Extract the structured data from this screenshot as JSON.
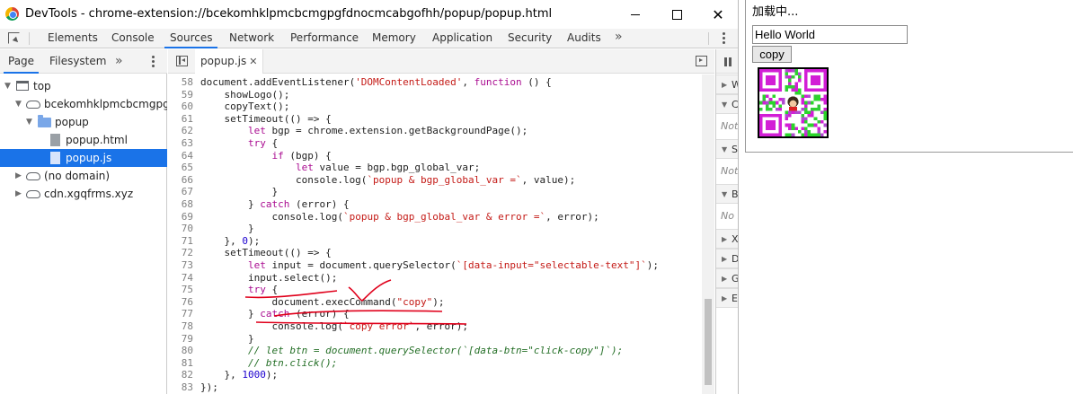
{
  "window": {
    "title": "DevTools - chrome-extension://bcekomhklpmcbcmgpgfdnocmcabgofhh/popup/popup.html",
    "minimize_icon": "minimize-icon",
    "maximize_icon": "maximize-icon",
    "close_glyph": "✕"
  },
  "toolbar": {
    "tabs": [
      "Elements",
      "Console",
      "Sources",
      "Network",
      "Performance",
      "Memory",
      "Application",
      "Security",
      "Audits"
    ],
    "active_tab": "Sources",
    "more_glyph": "»"
  },
  "navigator": {
    "tabs": [
      "Page",
      "Filesystem"
    ],
    "active_tab": "Page",
    "more_glyph": "»",
    "tree": [
      {
        "label": "top",
        "icon": "frame-icon"
      },
      {
        "label": "bcekomhklpmcbcmgpgfdnocmcabgofhh",
        "icon": "cloud-icon"
      },
      {
        "label": "popup",
        "icon": "folder-icon"
      },
      {
        "label": "popup.html",
        "icon": "file-icon"
      },
      {
        "label": "popup.js",
        "icon": "file-icon",
        "selected": true
      },
      {
        "label": "(no domain)",
        "icon": "cloud-icon"
      },
      {
        "label": "cdn.xgqfrms.xyz",
        "icon": "cloud-icon"
      }
    ]
  },
  "editor": {
    "open_file": "popup.js",
    "close_glyph": "✕",
    "first_line_number": 58,
    "lines": [
      "document.addEventListener('DOMContentLoaded', function () {",
      "    showLogo();",
      "    copyText();",
      "    setTimeout(() => {",
      "        let bgp = chrome.extension.getBackgroundPage();",
      "        try {",
      "            if (bgp) {",
      "                let value = bgp.bgp_global_var;",
      "                console.log(`popup & bgp_global_var =`, value);",
      "            }",
      "        } catch (error) {",
      "            console.log(`popup & bgp_global_var & error =`, error);",
      "        }",
      "    }, 0);",
      "    setTimeout(() => {",
      "        let input = document.querySelector(`[data-input=\"selectable-text\"]`);",
      "        input.select();",
      "        try {",
      "            document.execCommand(\"copy\");",
      "        } catch (error) {",
      "            console.log(`copy error`, error);",
      "        }",
      "        // let btn = document.querySelector(`[data-btn=\"click-copy\"]`);",
      "        // btn.click();",
      "    }, 1000);",
      "});"
    ]
  },
  "debugger": {
    "panes": [
      {
        "header": "Watch",
        "body": ""
      },
      {
        "header": "Call Stack",
        "body": "Not paused"
      },
      {
        "header": "Scope",
        "body": "Not paused"
      },
      {
        "header": "Breakpoints",
        "body": "No breakpoints"
      },
      {
        "header": "XHR/fetch Breakpoints",
        "body": ""
      },
      {
        "header": "DOM Breakpoints",
        "body": ""
      },
      {
        "header": "Global Listeners",
        "body": ""
      },
      {
        "header": "Event Listener Breakpoints",
        "body": ""
      }
    ]
  },
  "popup": {
    "loading_text": "加载中...",
    "input_value": "Hello World",
    "copy_label": "copy"
  },
  "colors": {
    "accent": "#1a73e8",
    "annotation": "#e0001b",
    "keyword": "#aa0d91",
    "string": "#c41a16",
    "number": "#1c00cf",
    "comment": "#236e25"
  }
}
